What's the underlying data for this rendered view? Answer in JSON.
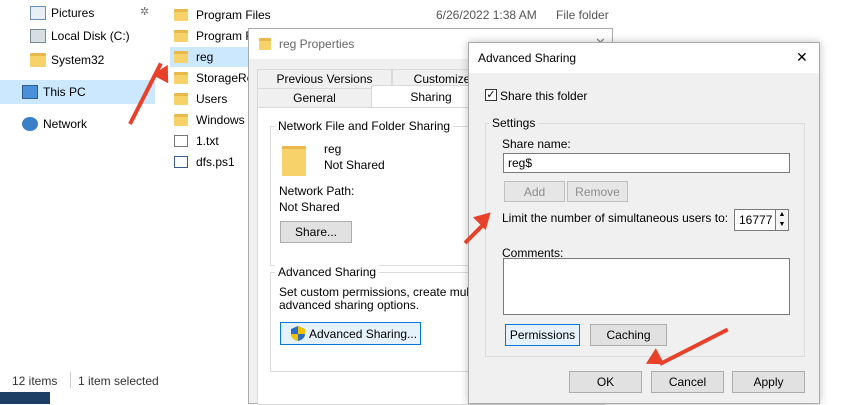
{
  "nav": {
    "items": [
      {
        "label": "Pictures",
        "icon": "pictures-icon"
      },
      {
        "label": "Local Disk (C:)",
        "icon": "drive-icon"
      },
      {
        "label": "System32",
        "icon": "folder-icon"
      },
      {
        "label": "This PC",
        "icon": "computer-icon"
      },
      {
        "label": "Network",
        "icon": "network-icon"
      }
    ]
  },
  "files": {
    "items": [
      {
        "name": "Program Files"
      },
      {
        "name": "Program F"
      },
      {
        "name": "reg"
      },
      {
        "name": "StorageRe"
      },
      {
        "name": "Users"
      },
      {
        "name": "Windows"
      },
      {
        "name": "1.txt"
      },
      {
        "name": "dfs.ps1"
      }
    ],
    "first_date": "6/26/2022 1:38 AM",
    "first_type": "File folder"
  },
  "status": {
    "items_count": "12 items",
    "selected": "1 item selected"
  },
  "properties": {
    "title": "reg Properties",
    "tabs": [
      "Previous Versions",
      "Customize",
      "General",
      "Sharing"
    ],
    "network_group": "Network File and Folder Sharing",
    "folder_name": "reg",
    "folder_status": "Not Shared",
    "network_path_label": "Network Path:",
    "network_path_value": "Not Shared",
    "share_button": "Share...",
    "advanced_group": "Advanced Sharing",
    "advanced_text_1": "Set custom permissions, create multiple s",
    "advanced_text_2": "advanced sharing options.",
    "advanced_button": "Advanced Sharing..."
  },
  "advanced": {
    "title": "Advanced Sharing",
    "share_checkbox": "Share this folder",
    "settings_group": "Settings",
    "share_name_label": "Share name:",
    "share_name_value": "reg$",
    "add_button": "Add",
    "remove_button": "Remove",
    "limit_label": "Limit the number of simultaneous users to:",
    "limit_value": "16777",
    "comments_label": "Comments:",
    "permissions_button": "Permissions",
    "caching_button": "Caching",
    "ok_button": "OK",
    "cancel_button": "Cancel",
    "apply_button": "Apply"
  },
  "colors": {
    "selection": "#cce8ff",
    "annotation_arrow": "#e8402a",
    "focus_border": "#0078d7"
  }
}
